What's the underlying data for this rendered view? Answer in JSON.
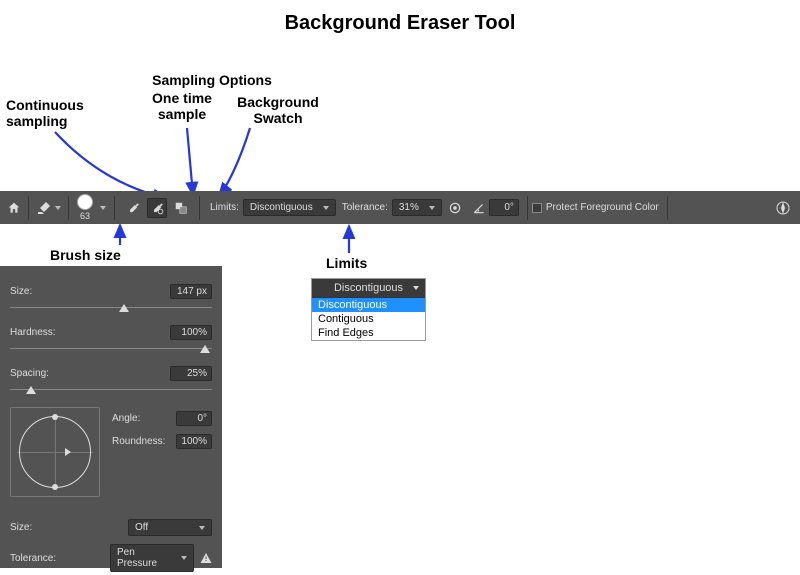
{
  "title": "Background Eraser Tool",
  "annotations": {
    "continuous": "Continuous\nsampling",
    "sampling_options": "Sampling Options",
    "one_time": "One time\nsample",
    "bg_swatch": "Background\nSwatch",
    "brush_size": "Brush size",
    "limits": "Limits"
  },
  "toolbar": {
    "brush_size": "63",
    "limits_label": "Limits:",
    "limits_value": "Discontiguous",
    "tolerance_label": "Tolerance:",
    "tolerance_value": "31%",
    "angle_value": "0°",
    "protect_label": "Protect Foreground Color"
  },
  "brush_panel": {
    "size_label": "Size:",
    "size_value": "147 px",
    "hardness_label": "Hardness:",
    "hardness_value": "100%",
    "spacing_label": "Spacing:",
    "spacing_value": "25%",
    "angle_label": "Angle:",
    "angle_value": "0°",
    "roundness_label": "Roundness:",
    "roundness_value": "100%",
    "size_jitter_label": "Size:",
    "size_jitter_value": "Off",
    "tolerance_jitter_label": "Tolerance:",
    "tolerance_jitter_value": "Pen Pressure"
  },
  "limits_popup": {
    "header": "Discontiguous",
    "opt1": "Discontiguous",
    "opt2": "Contiguous",
    "opt3": "Find Edges"
  }
}
